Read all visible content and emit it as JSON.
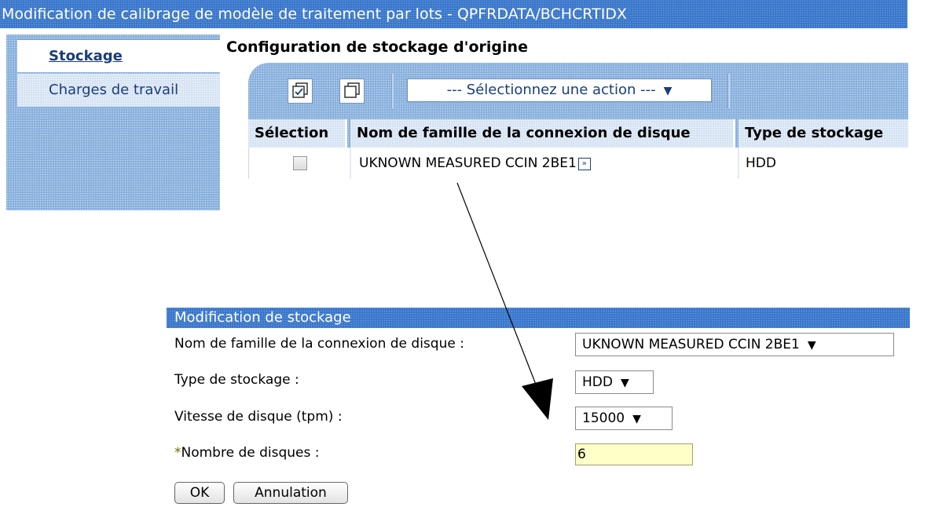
{
  "window": {
    "title": "Modification de calibrage de modèle de traitement par lots - QPFRDATA/BCHCRTIDX"
  },
  "sidebar": {
    "items": [
      {
        "label": "Stockage",
        "selected": true
      },
      {
        "label": "Charges de travail",
        "selected": false
      }
    ]
  },
  "section": {
    "title": "Configuration de stockage d'origine"
  },
  "toolbar": {
    "select_all_icon": "select-all-icon",
    "deselect_all_icon": "deselect-all-icon",
    "action_select_label": "--- Sélectionnez une action ---"
  },
  "table": {
    "headers": [
      "Sélection",
      "Nom de famille de la connexion de disque",
      "Type de stockage"
    ],
    "rows": [
      {
        "selected": false,
        "name": "UKNOWN MEASURED CCIN 2BE1",
        "type": "HDD"
      }
    ]
  },
  "dialog": {
    "title": "Modification de stockage",
    "fields": {
      "family_label": "Nom de famille de la connexion de disque :",
      "family_value": "UKNOWN MEASURED CCIN 2BE1",
      "type_label": "Type de stockage :",
      "type_value": "HDD",
      "speed_label": "Vitesse de disque (tpm) :",
      "speed_value": "15000",
      "required_marker": "*",
      "disks_label": "Nombre de disques :",
      "disks_value": "6"
    },
    "buttons": {
      "ok": "OK",
      "cancel": "Annulation"
    }
  },
  "colors": {
    "titlebar": "#3f7ccf",
    "panel": "#8fb6e0",
    "required_marker": "#6b6b00",
    "input_bg": "#ffffc8"
  }
}
